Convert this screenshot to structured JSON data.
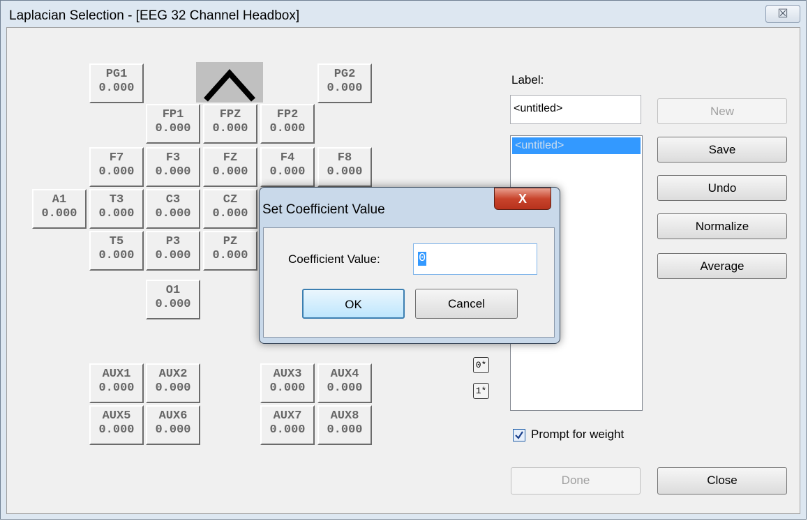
{
  "window": {
    "title": "Laplacian Selection - [EEG 32 Channel Headbox]",
    "close_glyph": "☒"
  },
  "electrodes": [
    {
      "id": "PG1",
      "name": "PG1",
      "value": "0.000"
    },
    {
      "id": "PG2",
      "name": "PG2",
      "value": "0.000"
    },
    {
      "id": "FP1",
      "name": "FP1",
      "value": "0.000"
    },
    {
      "id": "FPZ",
      "name": "FPZ",
      "value": "0.000"
    },
    {
      "id": "FP2",
      "name": "FP2",
      "value": "0.000"
    },
    {
      "id": "F7",
      "name": "F7",
      "value": "0.000"
    },
    {
      "id": "F3",
      "name": "F3",
      "value": "0.000"
    },
    {
      "id": "FZ",
      "name": "FZ",
      "value": "0.000"
    },
    {
      "id": "F4",
      "name": "F4",
      "value": "0.000"
    },
    {
      "id": "F8",
      "name": "F8",
      "value": "0.000"
    },
    {
      "id": "A1",
      "name": "A1",
      "value": "0.000"
    },
    {
      "id": "T3",
      "name": "T3",
      "value": "0.000"
    },
    {
      "id": "C3",
      "name": "C3",
      "value": "0.000"
    },
    {
      "id": "CZ",
      "name": "CZ",
      "value": "0.000"
    },
    {
      "id": "T5",
      "name": "T5",
      "value": "0.000"
    },
    {
      "id": "P3",
      "name": "P3",
      "value": "0.000"
    },
    {
      "id": "PZ",
      "name": "PZ",
      "value": "0.000"
    },
    {
      "id": "O1",
      "name": "O1",
      "value": "0.000"
    },
    {
      "id": "AUX1",
      "name": "AUX1",
      "value": "0.000"
    },
    {
      "id": "AUX2",
      "name": "AUX2",
      "value": "0.000"
    },
    {
      "id": "AUX3",
      "name": "AUX3",
      "value": "0.000"
    },
    {
      "id": "AUX4",
      "name": "AUX4",
      "value": "0.000"
    },
    {
      "id": "AUX5",
      "name": "AUX5",
      "value": "0.000"
    },
    {
      "id": "AUX6",
      "name": "AUX6",
      "value": "0.000"
    },
    {
      "id": "AUX7",
      "name": "AUX7",
      "value": "0.000"
    },
    {
      "id": "AUX8",
      "name": "AUX8",
      "value": "0.000"
    }
  ],
  "nose_icon": "up-caret-icon",
  "small_buttons": {
    "zero": "0*",
    "one": "1*"
  },
  "panel": {
    "label_caption": "Label:",
    "label_value": "<untitled>",
    "list_items": [
      "<untitled>"
    ],
    "buttons": {
      "new": "New",
      "save": "Save",
      "undo": "Undo",
      "normalize": "Normalize",
      "average": "Average",
      "done": "Done",
      "close": "Close"
    },
    "prompt_checkbox": {
      "label": "Prompt for weight",
      "checked": true
    }
  },
  "dialog": {
    "title": "Set Coefficient Value",
    "close_glyph": "X",
    "field_label": "Coefficient Value:",
    "field_value": "0",
    "ok": "OK",
    "cancel": "Cancel"
  }
}
